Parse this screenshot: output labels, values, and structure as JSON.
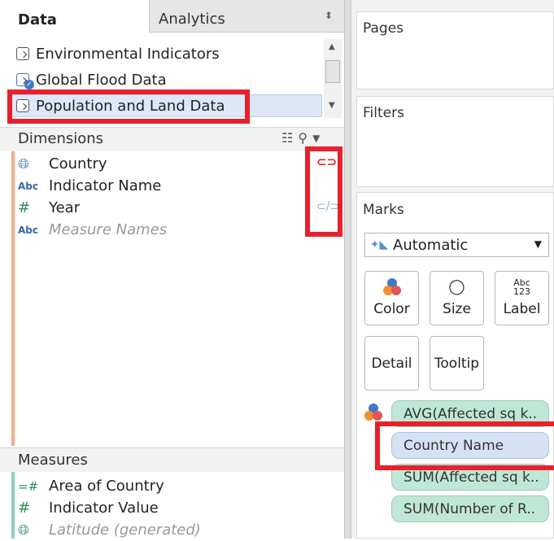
{
  "tabs": {
    "data": "Data",
    "analytics": "Analytics"
  },
  "data_sources": [
    {
      "label": "Environmental Indicators"
    },
    {
      "label": "Global Flood Data"
    },
    {
      "label": "Population and Land Data"
    }
  ],
  "dimensions": {
    "title": "Dimensions",
    "fields": [
      {
        "type": "globe",
        "name": "Country"
      },
      {
        "type": "Abc",
        "name": "Indicator Name"
      },
      {
        "type": "#",
        "name": "Year"
      },
      {
        "type": "Abc",
        "name": "Measure Names"
      }
    ]
  },
  "measures": {
    "title": "Measures",
    "fields": [
      {
        "type": "=#",
        "name": "Area of Country"
      },
      {
        "type": "#",
        "name": "Indicator Value"
      },
      {
        "type": "globe",
        "name": "Latitude (generated)"
      }
    ]
  },
  "right": {
    "pages": "Pages",
    "filters": "Filters",
    "marks": "Marks",
    "mark_type": "Automatic",
    "buttons": {
      "color": "Color",
      "size": "Size",
      "label": "Label",
      "label_icon": "Abc\n123",
      "detail": "Detail",
      "tooltip": "Tooltip"
    },
    "pills": [
      "AVG(Affected sq k..",
      "Country Name",
      "SUM(Affected sq k..",
      "SUM(Number of R.."
    ]
  },
  "colors": {
    "highlight": "#e8202c",
    "dimension_accent": "#f4ad85",
    "measure_accent": "#8ccfc0",
    "pill_green": "#bfe7d6",
    "pill_blue": "#d5e2f4"
  }
}
